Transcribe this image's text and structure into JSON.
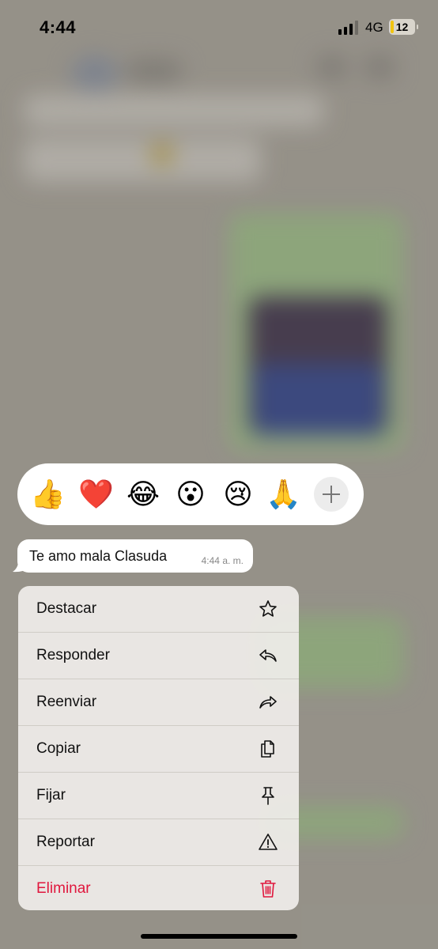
{
  "status_bar": {
    "time": "4:44",
    "network": "4G",
    "battery": "12",
    "signal_bars": 3,
    "signal_bars_total": 4
  },
  "reactions": {
    "emojis": [
      "👍",
      "❤️",
      "😂",
      "😮",
      "😢",
      "🙏"
    ],
    "more_icon": "plus-icon"
  },
  "message": {
    "text": "Te amo mala Clasuda",
    "time": "4:44 a. m."
  },
  "menu": {
    "items": [
      {
        "label": "Destacar",
        "icon": "star-icon"
      },
      {
        "label": "Responder",
        "icon": "reply-icon"
      },
      {
        "label": "Reenviar",
        "icon": "forward-icon"
      },
      {
        "label": "Copiar",
        "icon": "copy-icon"
      },
      {
        "label": "Fijar",
        "icon": "pin-icon"
      },
      {
        "label": "Reportar",
        "icon": "warning-icon"
      },
      {
        "label": "Eliminar",
        "icon": "trash-icon"
      }
    ]
  },
  "colors": {
    "danger": "#e0173d",
    "battery_level": "#f1c40f"
  }
}
